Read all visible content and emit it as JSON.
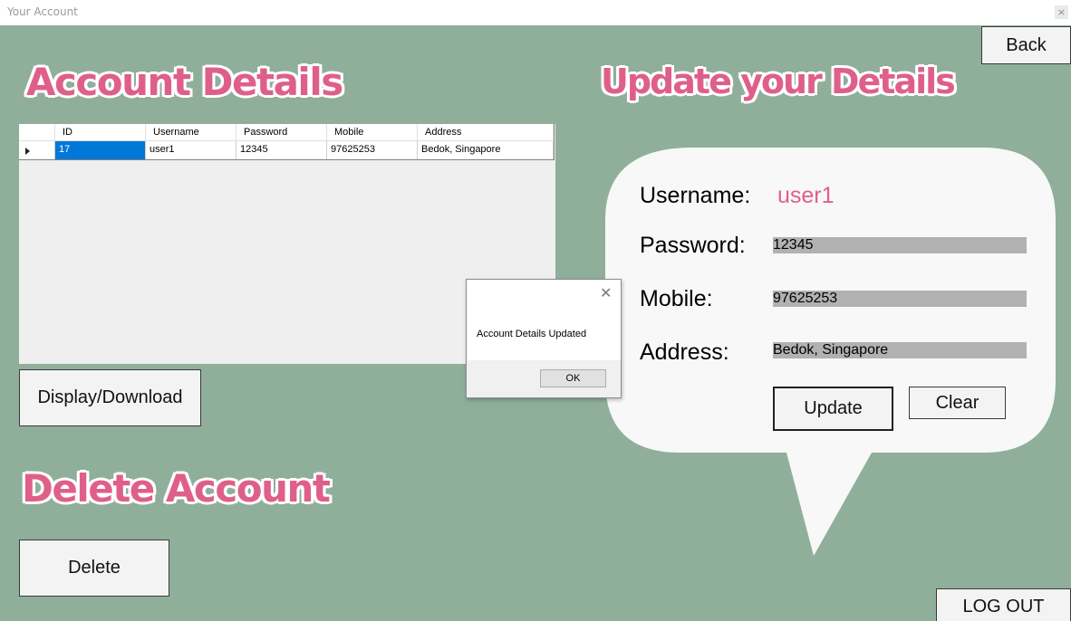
{
  "window": {
    "title": "Your Account",
    "close_glyph": "×"
  },
  "back_label": "Back",
  "account_heading": "Account Details",
  "update_heading": "Update your Details",
  "delete_heading": "Delete Account",
  "grid": {
    "columns": [
      "ID",
      "Username",
      "Password",
      "Mobile",
      "Address"
    ],
    "rows": [
      {
        "id": "17",
        "username": "user1",
        "password": "12345",
        "mobile": "97625253",
        "address": "Bedok, Singapore"
      }
    ]
  },
  "display_download_label": "Display/Download",
  "delete_label": "Delete",
  "form": {
    "username_label": "Username:",
    "username_value": "user1",
    "password_label": "Password:",
    "password_value": "12345",
    "mobile_label": "Mobile:",
    "mobile_value": "97625253",
    "address_label": "Address:",
    "address_value": "Bedok, Singapore",
    "update_label": "Update",
    "clear_label": "Clear"
  },
  "logout_label": "LOG OUT",
  "message_box": {
    "text": "Account Details Updated",
    "ok_label": "OK",
    "close_glyph": "✕"
  },
  "colors": {
    "background": "#8faf9b",
    "heading": "#df5f8b",
    "selection": "#0078d7",
    "field": "#b1b1b1"
  }
}
